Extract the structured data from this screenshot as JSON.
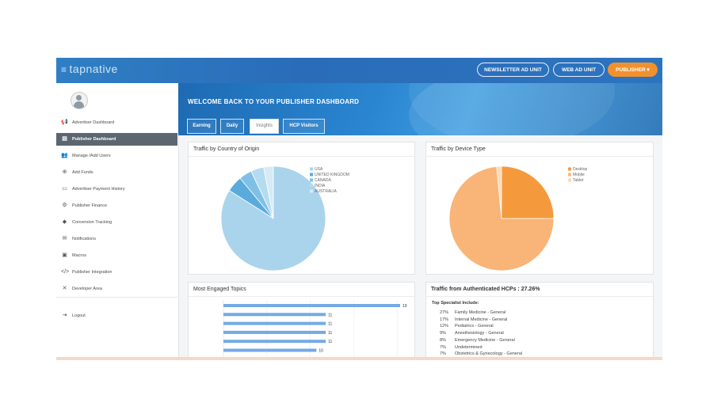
{
  "brand": {
    "name": "tapnative",
    "menu_icon": "hamburger-icon"
  },
  "header": {
    "buttons": [
      "NEWSLETTER AD UNIT",
      "WEB AD UNIT",
      "PUBLISHER ▾"
    ]
  },
  "sidebar": {
    "items": [
      {
        "label": "Advertiser Dashboard",
        "icon": "megaphone-icon",
        "glyph": "📢"
      },
      {
        "label": "Publisher Dashboard",
        "icon": "book-icon",
        "glyph": "▤",
        "active": true
      },
      {
        "label": "Manage /Add Users",
        "icon": "users-icon",
        "glyph": "👥"
      },
      {
        "label": "Add Funds",
        "icon": "funds-icon",
        "glyph": "⊕"
      },
      {
        "label": "Advertiser Payment History",
        "icon": "card-icon",
        "glyph": "▭"
      },
      {
        "label": "Publisher Finance",
        "icon": "gear-icon",
        "glyph": "⚙"
      },
      {
        "label": "Conversion Tracking",
        "icon": "tag-icon",
        "glyph": "◆"
      },
      {
        "label": "Notifications",
        "icon": "envelope-icon",
        "glyph": "✉"
      },
      {
        "label": "Macros",
        "icon": "monitor-icon",
        "glyph": "▣"
      },
      {
        "label": "Publisher Integration",
        "icon": "code-icon",
        "glyph": "</>"
      },
      {
        "label": "Developer Area",
        "icon": "shuffle-icon",
        "glyph": "✕"
      },
      {
        "label": "Logout",
        "icon": "logout-icon",
        "glyph": "⇥"
      }
    ]
  },
  "hero": {
    "title": "WELCOME BACK TO YOUR PUBLISHER DASHBOARD"
  },
  "tabs": [
    {
      "label": "Earning"
    },
    {
      "label": "Daily"
    },
    {
      "label": "Insights",
      "active": true
    },
    {
      "label": "HCP Visitors"
    }
  ],
  "cards": {
    "country": {
      "title": "Traffic by Country of Origin"
    },
    "device": {
      "title": "Traffic by Device Type"
    },
    "topics": {
      "title": "Most Engaged Topics"
    },
    "hcp": {
      "title": "Traffic from Authenticated HCPs : 27.26%",
      "subhead": "Top Specialist Include:",
      "rows": [
        {
          "pct": "27%",
          "label": "Family Medicine - General"
        },
        {
          "pct": "17%",
          "label": "Internal Medicine - General"
        },
        {
          "pct": "12%",
          "label": "Pediatrics - General"
        },
        {
          "pct": "9%",
          "label": "Anesthesiology - General"
        },
        {
          "pct": "8%",
          "label": "Emergency Medicine - General"
        },
        {
          "pct": "7%",
          "label": "Undetermined"
        },
        {
          "pct": "7%",
          "label": "Obstetrics & Gynecology - General"
        }
      ]
    }
  },
  "colors": {
    "accent": "#f1912e",
    "primary_blue": "#2a7fc8",
    "pie_country": "#a9d4ec",
    "bar_blue": "#75a9e6",
    "desktop": "#f49a3d",
    "mobile": "#f8b577",
    "tablet": "#fcd9b6"
  },
  "chart_data": [
    {
      "type": "pie",
      "title": "Traffic by Country of Origin",
      "categories": [
        "USA",
        "UNITED KINGDOM",
        "CANADA",
        "INDIA",
        "AUSTRALIA"
      ],
      "values": [
        84,
        5,
        4,
        4,
        3
      ],
      "colors": [
        "#a9d4ec",
        "#5aabdc",
        "#7fc0e6",
        "#b5dbf0",
        "#d6ebf6"
      ],
      "legend": "top-right"
    },
    {
      "type": "pie",
      "title": "Traffic by Device Type",
      "categories": [
        "Desktop",
        "Mobile",
        "Tablet"
      ],
      "values": [
        25,
        73.5,
        1.5
      ],
      "colors": [
        "#f49a3d",
        "#f8b577",
        "#fcd9b6"
      ],
      "legend": "top-right"
    },
    {
      "type": "bar",
      "title": "Most Engaged Topics",
      "orientation": "horizontal",
      "values": [
        19,
        11,
        11,
        11,
        11,
        10
      ],
      "xlim": [
        0,
        19
      ]
    }
  ]
}
